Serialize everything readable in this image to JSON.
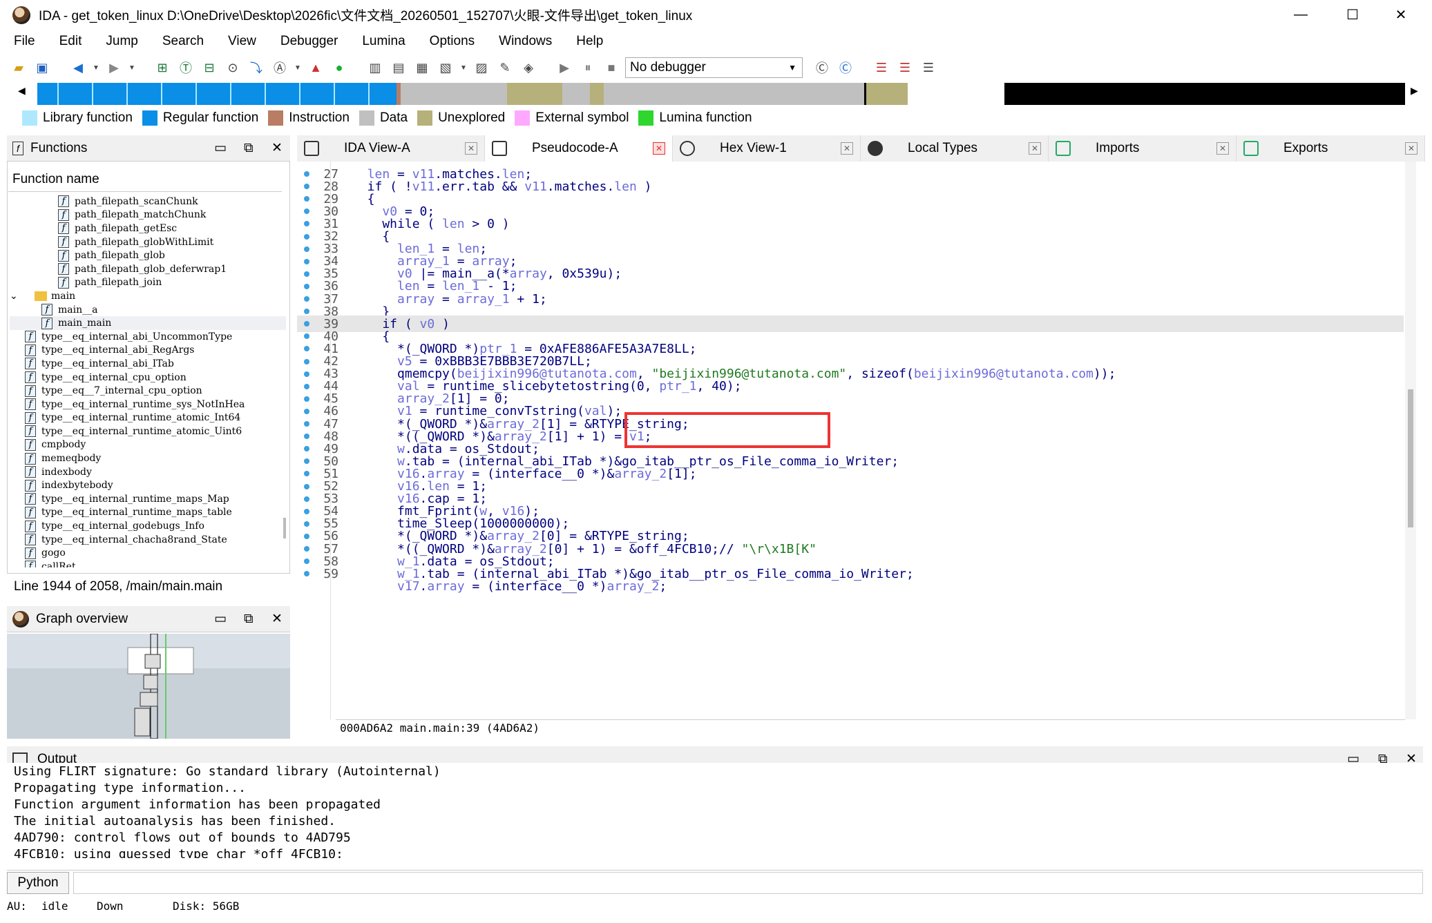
{
  "window": {
    "title": "IDA - get_token_linux D:\\OneDrive\\Desktop\\2026fic\\文件文档_20260501_152707\\火眼-文件导出\\get_token_linux",
    "minimize": "—",
    "maximize": "☐",
    "close": "✕"
  },
  "menu": [
    "File",
    "Edit",
    "Jump",
    "Search",
    "View",
    "Debugger",
    "Lumina",
    "Options",
    "Windows",
    "Help"
  ],
  "toolbar": {
    "debugger_select": "No debugger"
  },
  "legend": [
    {
      "label": "Library function",
      "color": "#aee8ff"
    },
    {
      "label": "Regular function",
      "color": "#0a8ee6"
    },
    {
      "label": "Instruction",
      "color": "#b87d63"
    },
    {
      "label": "Data",
      "color": "#c0c0c0"
    },
    {
      "label": "Unexplored",
      "color": "#b6b07a"
    },
    {
      "label": "External symbol",
      "color": "#ffa8ff"
    },
    {
      "label": "Lumina function",
      "color": "#2ed62e"
    }
  ],
  "functions_pane": {
    "title": "Functions",
    "column": "Function name",
    "items": [
      {
        "indent": 2,
        "kind": "f",
        "name": "path_filepath_scanChunk"
      },
      {
        "indent": 2,
        "kind": "f",
        "name": "path_filepath_matchChunk"
      },
      {
        "indent": 2,
        "kind": "f",
        "name": "path_filepath_getEsc"
      },
      {
        "indent": 2,
        "kind": "f",
        "name": "path_filepath_globWithLimit"
      },
      {
        "indent": 2,
        "kind": "f",
        "name": "path_filepath_glob"
      },
      {
        "indent": 2,
        "kind": "f",
        "name": "path_filepath_glob_deferwrap1"
      },
      {
        "indent": 2,
        "kind": "f",
        "name": "path_filepath_join"
      },
      {
        "indent": 0,
        "kind": "folder",
        "name": "main"
      },
      {
        "indent": 1,
        "kind": "f",
        "name": "main__a"
      },
      {
        "indent": 1,
        "kind": "f",
        "name": "main_main"
      },
      {
        "indent": 0,
        "kind": "f",
        "name": "type__eq_internal_abi_UncommonType"
      },
      {
        "indent": 0,
        "kind": "f",
        "name": "type__eq_internal_abi_RegArgs"
      },
      {
        "indent": 0,
        "kind": "f",
        "name": "type__eq_internal_abi_ITab"
      },
      {
        "indent": 0,
        "kind": "f",
        "name": "type__eq_internal_cpu_option"
      },
      {
        "indent": 0,
        "kind": "f",
        "name": "type__eq__7_internal_cpu_option"
      },
      {
        "indent": 0,
        "kind": "f",
        "name": "type__eq_internal_runtime_sys_NotInHea"
      },
      {
        "indent": 0,
        "kind": "f",
        "name": "type__eq_internal_runtime_atomic_Int64"
      },
      {
        "indent": 0,
        "kind": "f",
        "name": "type__eq_internal_runtime_atomic_Uint6"
      },
      {
        "indent": 0,
        "kind": "f",
        "name": "cmpbody"
      },
      {
        "indent": 0,
        "kind": "f",
        "name": "memeqbody"
      },
      {
        "indent": 0,
        "kind": "f",
        "name": "indexbody"
      },
      {
        "indent": 0,
        "kind": "f",
        "name": "indexbytebody"
      },
      {
        "indent": 0,
        "kind": "f",
        "name": "type__eq_internal_runtime_maps_Map"
      },
      {
        "indent": 0,
        "kind": "f",
        "name": "type__eq_internal_runtime_maps_table"
      },
      {
        "indent": 0,
        "kind": "f",
        "name": "type__eq_internal_godebugs_Info"
      },
      {
        "indent": 0,
        "kind": "f",
        "name": "type__eq_internal_chacha8rand_State"
      },
      {
        "indent": 0,
        "kind": "f",
        "name": "gogo"
      },
      {
        "indent": 0,
        "kind": "f",
        "name": "callRet"
      }
    ],
    "status": "Line 1944 of 2058, /main/main.main"
  },
  "graph_overview": {
    "title": "Graph overview"
  },
  "tabs": [
    {
      "label": "IDA View-A",
      "active": false
    },
    {
      "label": "Pseudocode-A",
      "active": true
    },
    {
      "label": "Hex View-1",
      "active": false
    },
    {
      "label": "Local Types",
      "active": false
    },
    {
      "label": "Imports",
      "active": false
    },
    {
      "label": "Exports",
      "active": false
    }
  ],
  "code_lines": [
    {
      "n": "27",
      "t": "  len = v11.matches.len;"
    },
    {
      "n": "28",
      "t": "  if ( !v11.err.tab && v11.matches.len )"
    },
    {
      "n": "29",
      "t": "  {"
    },
    {
      "n": "30",
      "t": "    v0 = 0;"
    },
    {
      "n": "31",
      "t": "    while ( len > 0 )"
    },
    {
      "n": "32",
      "t": "    {"
    },
    {
      "n": "33",
      "t": "      len_1 = len;"
    },
    {
      "n": "34",
      "t": "      array_1 = array;"
    },
    {
      "n": "35",
      "t": "      v0 |= main__a(*array, 0x539u);"
    },
    {
      "n": "36",
      "t": "      len = len_1 - 1;"
    },
    {
      "n": "37",
      "t": "      array = array_1 + 1;"
    },
    {
      "n": "38",
      "t": "    }"
    },
    {
      "n": "39",
      "t": "    if ( v0 )"
    },
    {
      "n": "40",
      "t": "    {"
    },
    {
      "n": "41",
      "t": "      *(_QWORD *)ptr_1 = 0xAFE886AFE5A3A7E8LL;"
    },
    {
      "n": "42",
      "t": "      v5 = 0xBBB3E7BBB3E720B7LL;"
    },
    {
      "n": "43",
      "t": "      qmemcpy(beijixin996@tutanota.com, \"beijixin996@tutanota.com\", sizeof(beijixin996@tutanota.com));"
    },
    {
      "n": "44",
      "t": "      val = runtime_slicebytetostring(0, ptr_1, 40);"
    },
    {
      "n": "45",
      "t": "      array_2[1] = 0;"
    },
    {
      "n": "46",
      "t": "      v1 = runtime_convTstring(val);"
    },
    {
      "n": "47",
      "t": "      *(_QWORD *)&array_2[1] = &RTYPE_string;"
    },
    {
      "n": "48",
      "t": "      *((_QWORD *)&array_2[1] + 1) = v1;"
    },
    {
      "n": "49",
      "t": "      w.data = os_Stdout;"
    },
    {
      "n": "50",
      "t": "      w.tab = (internal_abi_ITab *)&go_itab__ptr_os_File_comma_io_Writer;"
    },
    {
      "n": "51",
      "t": "      v16.array = (interface__0 *)&array_2[1];"
    },
    {
      "n": "52",
      "t": "      v16.len = 1;"
    },
    {
      "n": "53",
      "t": "      v16.cap = 1;"
    },
    {
      "n": "54",
      "t": "      fmt_Fprint(w, v16);"
    },
    {
      "n": "55",
      "t": "      time_Sleep(1000000000);"
    },
    {
      "n": "56",
      "t": "      *(_QWORD *)&array_2[0] = &RTYPE_string;"
    },
    {
      "n": "57",
      "t": "      *((_QWORD *)&array_2[0] + 1) = &off_4FCB10;// \"\\r\\x1B[K\""
    },
    {
      "n": "58",
      "t": "      w_1.data = os_Stdout;"
    },
    {
      "n": "59",
      "t": "      w_1.tab = (internal_abi_ITab *)&go_itab__ptr_os_File_comma_io_Writer;"
    },
    {
      "n": "",
      "t": "      v17.array = (interface__0 *)array_2;"
    }
  ],
  "code_status": "000AD6A2 main.main:39 (4AD6A2)",
  "output_pane": {
    "title": "Output",
    "lines": [
      "Using FLIRT signature: Go standard library (Autointernal)",
      "Propagating type information...",
      "Function argument information has been propagated",
      "The initial autoanalysis has been finished.",
      "4AD790: control flows out of bounds to 4AD795",
      "4FCB10: using guessed type char *off_4FCB10;"
    ],
    "lang": "Python"
  },
  "statusbar": {
    "au": "AU:",
    "state": "idle",
    "dir": "Down",
    "disk": "Disk: 56GB"
  }
}
